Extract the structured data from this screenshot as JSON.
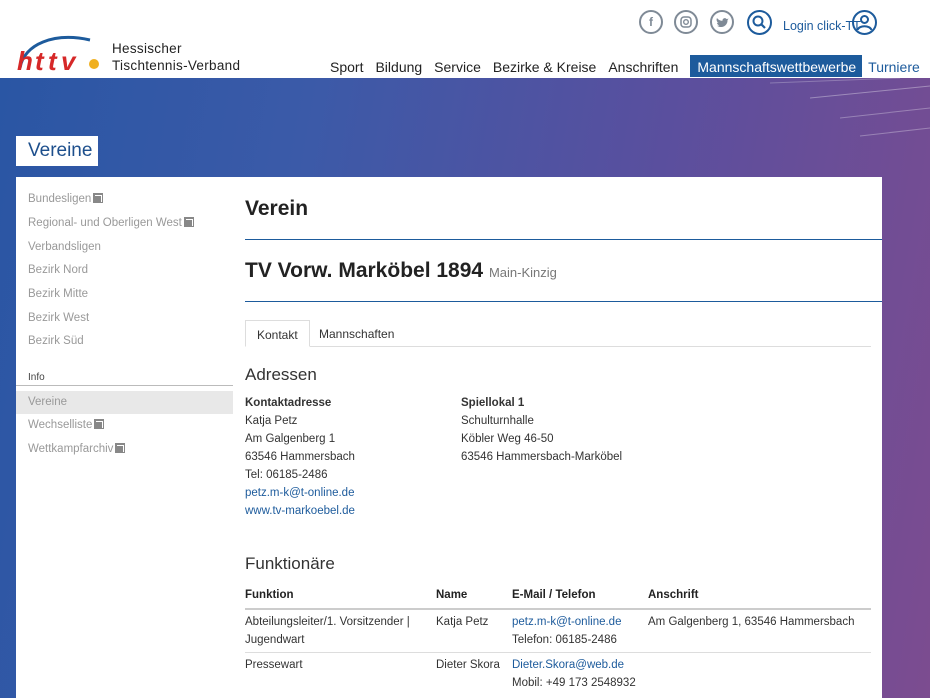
{
  "brand": {
    "line1": "Hessischer",
    "line2": "Tischtennis-Verband"
  },
  "header": {
    "login_label": "Login click-TT",
    "nav": [
      {
        "label": "Sport"
      },
      {
        "label": "Bildung"
      },
      {
        "label": "Service"
      },
      {
        "label": "Bezirke & Kreise"
      },
      {
        "label": "Anschriften"
      },
      {
        "label": "Mannschaftswettbewerbe",
        "active": true
      },
      {
        "label": "Turniere"
      }
    ]
  },
  "section_title": "Vereine",
  "sidebar": {
    "links": [
      {
        "label": "Bundesligen",
        "external": true
      },
      {
        "label": "Regional- und Oberligen West",
        "external": true
      },
      {
        "label": "Verbandsligen"
      },
      {
        "label": "Bezirk Nord"
      },
      {
        "label": "Bezirk Mitte"
      },
      {
        "label": "Bezirk West"
      },
      {
        "label": "Bezirk Süd"
      }
    ],
    "category": "Info",
    "info_links": [
      {
        "label": "Vereine",
        "active": true
      },
      {
        "label": "Wechselliste",
        "external": true
      },
      {
        "label": "Wettkampfarchiv",
        "external": true
      }
    ]
  },
  "main": {
    "heading": "Verein",
    "club_name": "TV Vorw. Marköbel 1894",
    "club_region": "Main-Kinzig",
    "tabs": [
      "Kontakt",
      "Mannschaften"
    ],
    "addresses_heading": "Adressen",
    "contact": {
      "title": "Kontaktadresse",
      "name": "Katja Petz",
      "street": "Am Galgenberg 1",
      "city": "63546 Hammersbach",
      "phone": "Tel: 06185-2486",
      "email": "petz.m-k@t-online.de",
      "web": "www.tv-markoebel.de"
    },
    "venue": {
      "title": "Spiellokal 1",
      "name": "Schulturnhalle",
      "street": "Köbler Weg 46-50",
      "city": "63546 Hammersbach-Marköbel"
    },
    "officials_heading": "Funktionäre",
    "table_headers": [
      "Funktion",
      "Name",
      "E-Mail / Telefon",
      "Anschrift"
    ],
    "officials": [
      {
        "function_l1": "Abteilungsleiter/1. Vorsitzender |",
        "function_l2": "Jugendwart",
        "name": "Katja Petz",
        "email": "petz.m-k@t-online.de",
        "phone": "Telefon: 06185-2486",
        "address": "Am Galgenberg 1, 63546 Hammersbach"
      },
      {
        "function_l1": "Pressewart",
        "name": "Dieter Skora",
        "email": "Dieter.Skora@web.de",
        "phone": "Mobil: +49 173 2548932"
      }
    ]
  },
  "colors": {
    "primary": "#1d5b9c",
    "banner_start": "#2a56a4",
    "banner_end": "#7c4c90"
  }
}
